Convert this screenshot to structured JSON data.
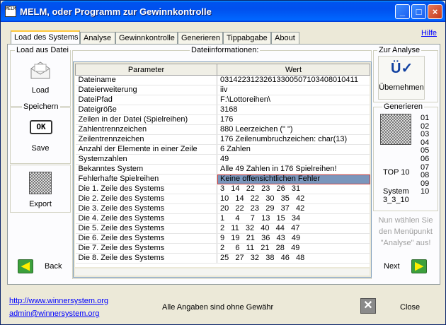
{
  "window": {
    "title": "MELM, oder Programm zur Gewinnkontrolle",
    "icon_text": "MELM"
  },
  "tabs": [
    {
      "label": "Load des Systems",
      "active": true
    },
    {
      "label": "Analyse"
    },
    {
      "label": "Gewinnkontrolle"
    },
    {
      "label": "Generieren"
    },
    {
      "label": "Tippabgabe"
    },
    {
      "label": "About"
    }
  ],
  "help_link": "Hilfe",
  "left": {
    "load_group": "Load aus Datei",
    "load_label": "Load",
    "save_group": "Speichern",
    "save_label": "Save",
    "save_icon_text": "OK",
    "export_label": "Export",
    "back_label": "Back"
  },
  "fileinfo": {
    "group": "Dateiinformationen:",
    "headers": [
      "Parameter",
      "Wert"
    ],
    "rows": [
      [
        "Dateiname",
        "03142231232613300507103408010411"
      ],
      [
        "Dateierweiterung",
        "iiv"
      ],
      [
        "DateiPfad",
        "F:\\Lottoreihen\\"
      ],
      [
        "Dateigröße",
        "3168"
      ],
      [
        "Zeilen in der Datei (Spielreihen)",
        "176"
      ],
      [
        "Zahlentrennzeichen",
        "880 Leerzeichen (\" \")"
      ],
      [
        "Zeilentrennzeichen",
        "176 Zeilenumbruchzeichen: char(13)"
      ],
      [
        "Anzahl der Elemente in einer Zeile",
        "6 Zahlen"
      ],
      [
        "Systemzahlen",
        "49"
      ],
      [
        "Bekanntes System",
        "Alle 49 Zahlen in 176 Spielreihen!"
      ],
      [
        "Fehlerhafte Spielreihen",
        "Keine offensichtlichen Fehler"
      ],
      [
        "Die 1. Zeile des Systems",
        "3   14   22   23   26   31"
      ],
      [
        "Die 2. Zeile des Systems",
        "10   14   22   30   35   42"
      ],
      [
        "Die 3. Zeile des Systems",
        "20   22   23   29   37   42"
      ],
      [
        "Die 4. Zeile des Systems",
        "1     4     7   13   15   34"
      ],
      [
        "Die 5. Zeile des Systems",
        "2   11   32   40   44   47"
      ],
      [
        "Die 6. Zeile des Systems",
        "9   19   21   36   43   49"
      ],
      [
        "Die 7. Zeile des Systems",
        "2     6   11   21   28   49"
      ],
      [
        "Die 8. Zeile des Systems",
        "25   27   32   38   46   48"
      ]
    ],
    "selected_row": 10
  },
  "right": {
    "analyse_group": "Zur Analyse",
    "uebernehmen_label": "Übernehmen",
    "generieren_group": "Generieren",
    "numbers": [
      "01",
      "02",
      "03",
      "04",
      "05",
      "06",
      "07",
      "08",
      "09",
      "10"
    ],
    "top_label": "TOP 10",
    "system_label": "System",
    "system_value": "3_3_10",
    "hint": "Nun wählen Sie den Menüpunkt \"Analyse\" aus!",
    "next_label": "Next"
  },
  "footer": {
    "website": "http://www.winnersystem.org",
    "email": "admin@winnersystem.org",
    "disclaimer": "Alle Angaben sind ohne Gewähr",
    "close_label": "Close"
  }
}
